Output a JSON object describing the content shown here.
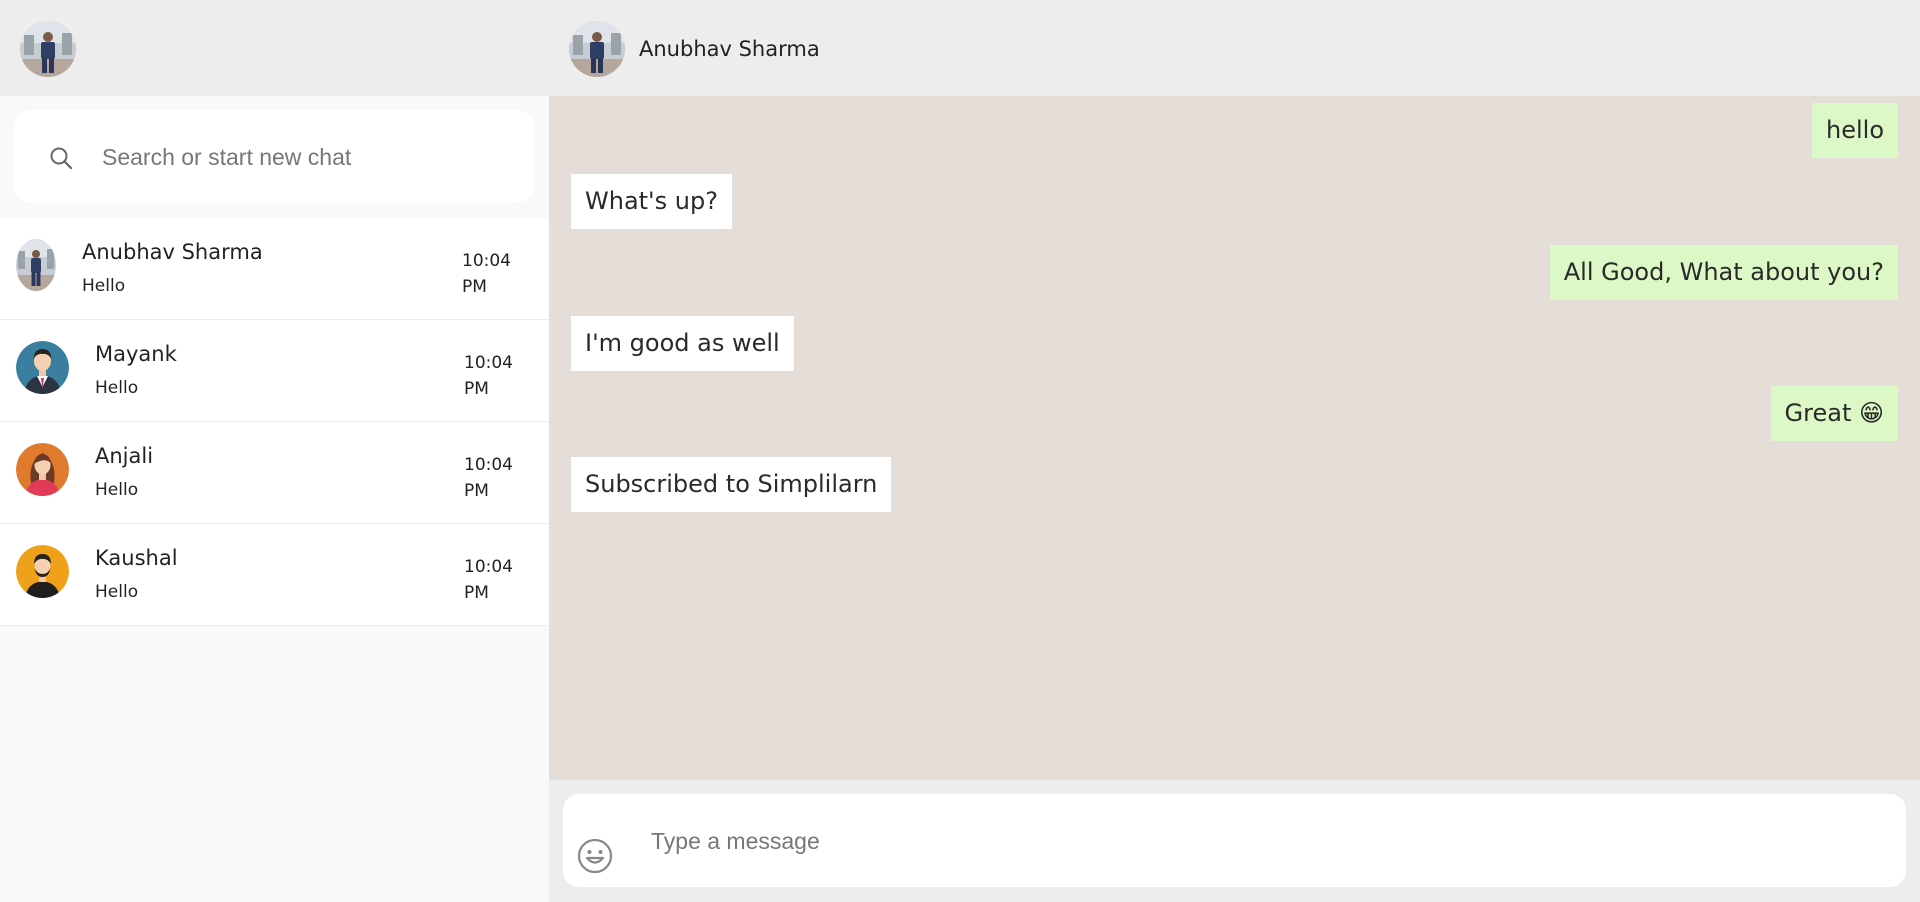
{
  "sidebar": {
    "search": {
      "placeholder": "Search or start new chat"
    },
    "chats": [
      {
        "name": "Anubhav Sharma",
        "preview": "Hello",
        "time": "10:04 PM",
        "avatar": "photo-man-avatar"
      },
      {
        "name": "Mayank",
        "preview": "Hello",
        "time": "10:04 PM",
        "avatar": "man-in-suit-avatar"
      },
      {
        "name": "Anjali",
        "preview": "Hello",
        "time": "10:04 PM",
        "avatar": "woman-avatar"
      },
      {
        "name": "Kaushal",
        "preview": "Hello",
        "time": "10:04 PM",
        "avatar": "man-bearded-avatar"
      }
    ]
  },
  "conversation": {
    "contact_name": "Anubhav Sharma",
    "messages": [
      {
        "direction": "out",
        "text": "hello"
      },
      {
        "direction": "in",
        "text": "What's up?"
      },
      {
        "direction": "out",
        "text": "All Good, What about you?"
      },
      {
        "direction": "in",
        "text": "I'm good as well"
      },
      {
        "direction": "out",
        "text": "Great 😁"
      },
      {
        "direction": "in",
        "text": "Subscribed to Simplilarn"
      }
    ]
  },
  "composer": {
    "placeholder": "Type a message"
  },
  "colors": {
    "outgoing_bubble": "#dcf8c6",
    "incoming_bubble": "#ffffff",
    "chat_background": "#e5ddd8",
    "header_background": "#ededed"
  }
}
